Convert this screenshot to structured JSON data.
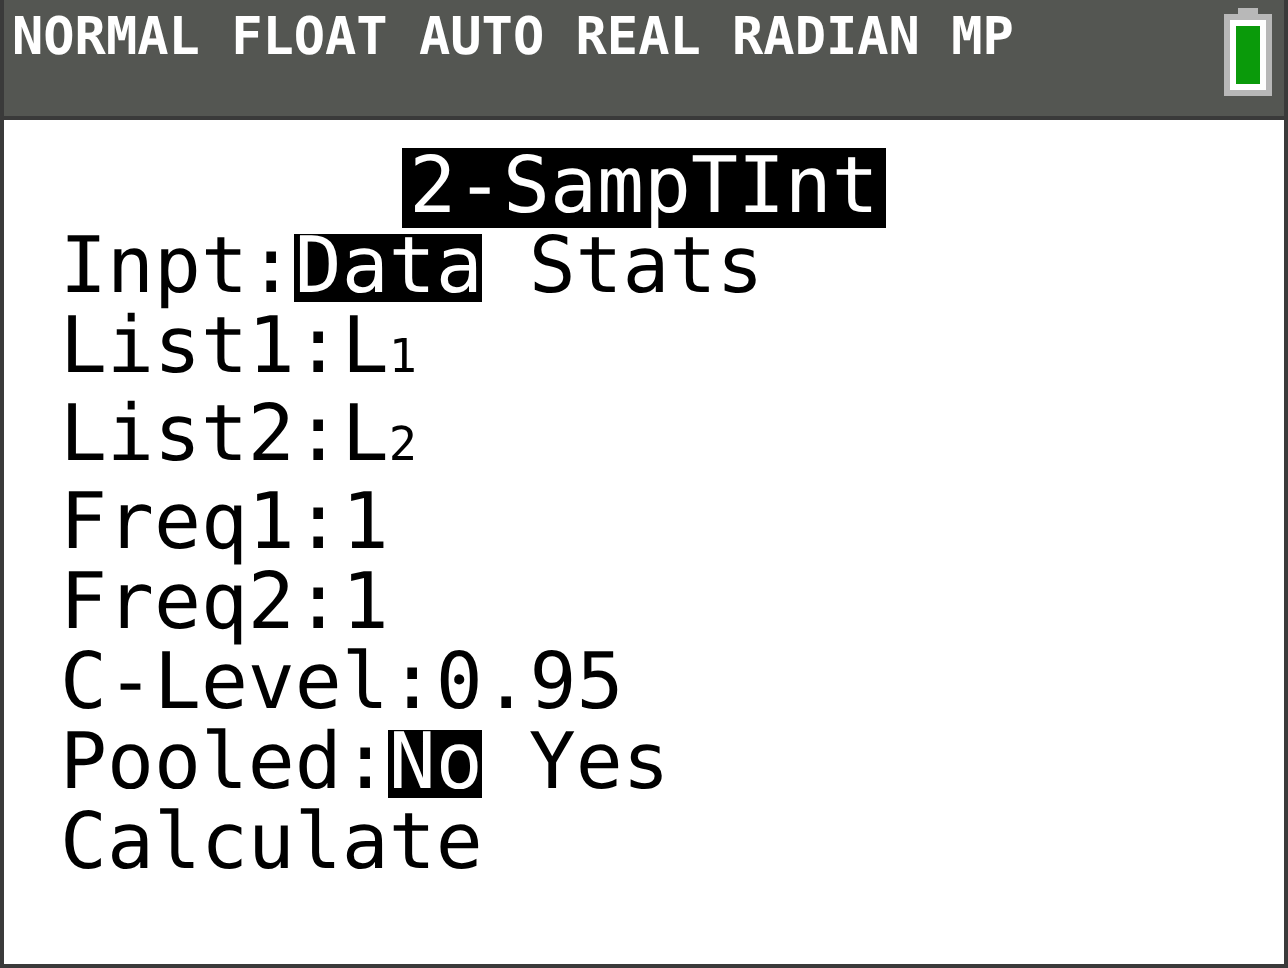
{
  "status_bar": {
    "modes": "NORMAL FLOAT AUTO REAL RADIAN MP"
  },
  "title": "2-SampTInt",
  "rows": [
    {
      "kind": "choice",
      "label": "Inpt:",
      "options": [
        {
          "label": "Data",
          "selected": true
        },
        {
          "label": "Stats",
          "selected": false
        }
      ]
    },
    {
      "kind": "field",
      "label": "List1:",
      "value": "L$_{1}$"
    },
    {
      "kind": "field",
      "label": "List2:",
      "value": "L$_{2}$"
    },
    {
      "kind": "field",
      "label": "Freq1:",
      "value": "1"
    },
    {
      "kind": "field",
      "label": "Freq2:",
      "value": "1"
    },
    {
      "kind": "field",
      "label": "C-Level:",
      "value": "0.95"
    },
    {
      "kind": "choice",
      "label": "Pooled:",
      "options": [
        {
          "label": "No",
          "selected": true
        },
        {
          "label": "Yes",
          "selected": false
        }
      ]
    },
    {
      "kind": "command",
      "label": "Calculate"
    }
  ]
}
